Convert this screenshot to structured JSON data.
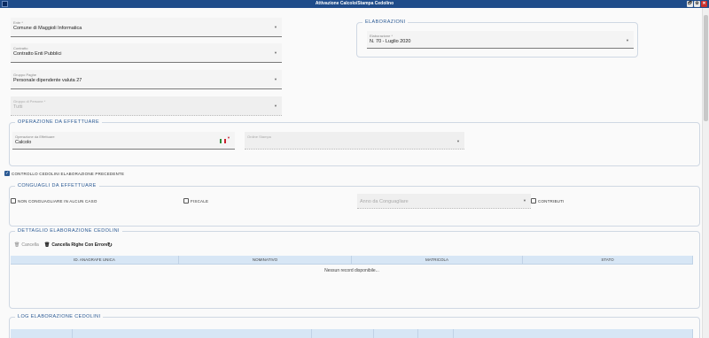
{
  "window": {
    "title": "Attivazione Calcolo/Stampa Cedolino",
    "controls": [
      "🗗",
      "⚙",
      "✕"
    ]
  },
  "left_fields": [
    {
      "label": "Ente *",
      "value": "Comune di Maggioli Informatica",
      "disabled": false
    },
    {
      "label": "Contratto",
      "value": "Contratto Enti Pubblici",
      "disabled": false
    },
    {
      "label": "Gruppo Paghe",
      "value": "Personale dipendente valuta 27",
      "disabled": false
    },
    {
      "label": "Gruppo di Persone *",
      "value": "Tutti",
      "disabled": true
    }
  ],
  "elaborazioni": {
    "legend": "ELABORAZIONI",
    "field_label": "Elaborazione *",
    "field_value": "N. 70 - Luglio 2020"
  },
  "operazione": {
    "legend": "OPERAZIONE DA EFFETTUARE",
    "op_label": "Operazione da Effettuare",
    "op_value": "Calcolo",
    "stampa_label": "Ordine Stampa",
    "stampa_value": ""
  },
  "controllo": {
    "label": "CONTROLLO CEDOLINI ELABORAZIONE PRECEDENTE",
    "checked": true
  },
  "conguagli": {
    "legend": "CONGUAGLI DA EFFETTUARE",
    "non_conguagliare": "NON CONGUAGLIARE IN ALCUN CASO",
    "fiscale": "FISCALE",
    "anno_placeholder": "Anno da Conguagliare",
    "contributi": "CONTRIBUTI"
  },
  "dettaglio": {
    "legend": "DETTAGLIO ELABORAZIONE CEDOLINI",
    "cancella": "Cancella",
    "cancella_righe": "Cancella Righe Con Errore",
    "columns": [
      "ID. ANAGRAFE UNICA",
      "NOMINATIVO",
      "MATRICOLA",
      "STATO"
    ],
    "empty": "Nessun record disponibile..."
  },
  "log": {
    "legend": "LOG ELABORAZIONE CEDOLINI"
  },
  "colors": {
    "titlebar": "#1f4c8a",
    "accent": "#2b5a94",
    "grid_header": "#d7e6f5"
  }
}
